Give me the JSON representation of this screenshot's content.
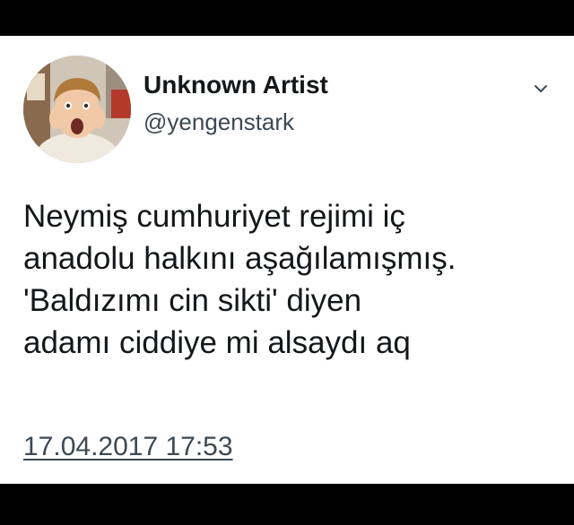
{
  "tweet": {
    "author": {
      "display_name": "Unknown Artist",
      "handle": "@yengenstark",
      "avatar": "avatar-photo"
    },
    "menu_icon": "chevron-down-icon",
    "text_lines": [
      "Neymiş cumhuriyet rejimi iç",
      "anadolu halkını aşağılamışmış.",
      "'Baldızımı cin sikti' diyen",
      "adamı ciddiye mi alsaydı aq"
    ],
    "timestamp": "17.04.2017 17:53"
  },
  "colors": {
    "background": "#ffffff",
    "letterbox": "#000000",
    "text_primary": "#14171a",
    "text_secondary": "#3d4852"
  }
}
